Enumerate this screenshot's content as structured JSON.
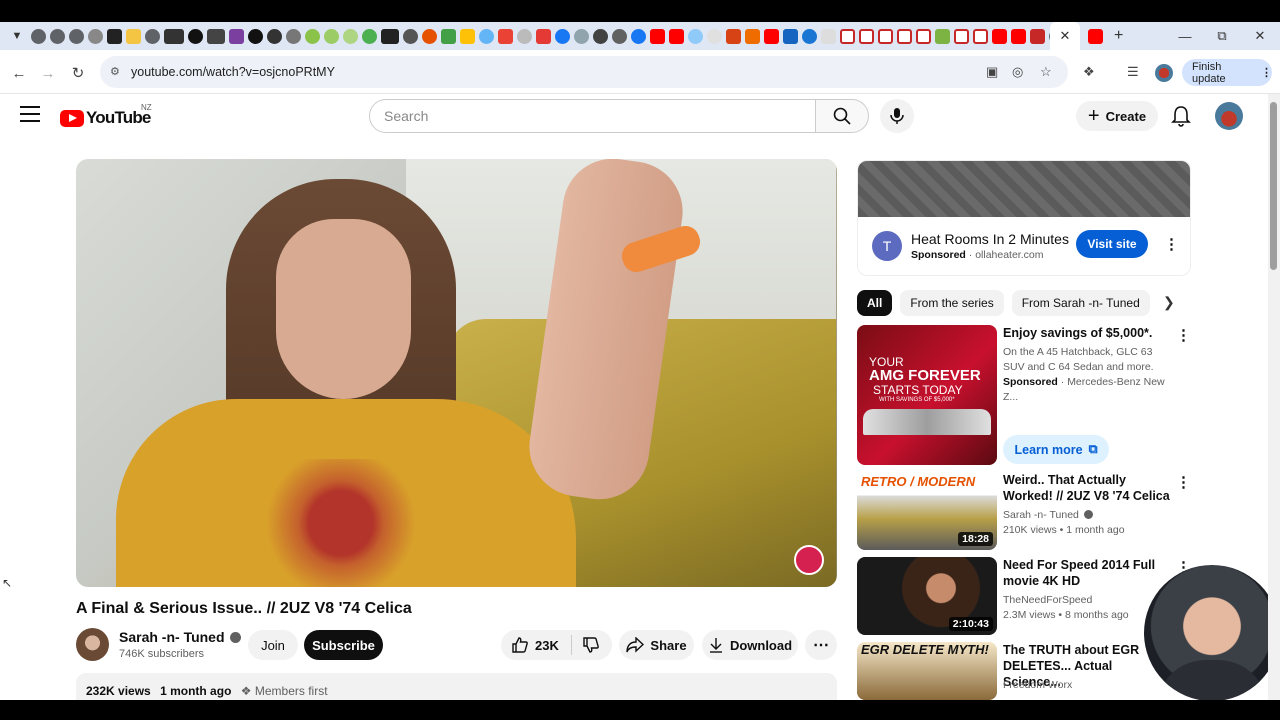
{
  "browser": {
    "url": "youtube.com/watch?v=osjcnoPRtMY",
    "finish_update": "Finish update"
  },
  "youtube": {
    "logo_text": "YouTube",
    "country": "NZ",
    "search_placeholder": "Search",
    "create_label": "Create"
  },
  "video": {
    "title": "A Final & Serious Issue.. // 2UZ V8 '74 Celica",
    "channel": "Sarah -n- Tuned",
    "subscribers": "746K subscribers",
    "join_label": "Join",
    "subscribe_label": "Subscribe",
    "likes": "23K",
    "share_label": "Share",
    "download_label": "Download",
    "views": "232K views",
    "age": "1 month ago",
    "members_first": "Members first"
  },
  "ad": {
    "letter": "T",
    "title": "Heat Rooms In 2 Minutes",
    "sponsored": "Sponsored",
    "domain": "ollaheater.com",
    "visit_label": "Visit site"
  },
  "chips": [
    "All",
    "From the series",
    "From Sarah -n- Tuned"
  ],
  "recommendations": [
    {
      "title": "Enjoy savings of $5,000*.",
      "desc": "On the A 45 Hatchback, GLC 63 SUV and C 64 Sedan and more.",
      "sponsored": "Sponsored",
      "advertiser": "Mercedes-Benz New Z...",
      "learn_more": "Learn more",
      "thumb_line1": "YOUR",
      "thumb_line2": "AMG FOREVER",
      "thumb_line3": "STARTS TODAY",
      "thumb_line4": "WITH SAVINGS OF $5,000*"
    },
    {
      "title": "Weird.. That Actually Worked! // 2UZ V8 '74 Celica",
      "channel": "Sarah -n- Tuned",
      "meta": "210K views • 1 month ago",
      "duration": "18:28",
      "thumb_text": "RETRO / MODERN"
    },
    {
      "title": "Need For Speed 2014 Full movie 4K HD",
      "channel": "TheNeedForSpeed",
      "meta": "2.3M views • 8 months ago",
      "duration": "2:10:43"
    },
    {
      "title": "The TRUTH about EGR DELETES... Actual Science...",
      "channel": "Freedom Worx",
      "thumb_text": "EGR DELETE MYTH!"
    }
  ],
  "icons": {
    "menu": "hamburger-icon",
    "search": "search-icon",
    "mic": "mic-icon",
    "bell": "bell-icon",
    "like": "thumbs-up-icon",
    "dislike": "thumbs-down-icon",
    "share": "share-icon",
    "download": "download-icon"
  },
  "colors": {
    "brand_red": "#ff0000",
    "visit_blue": "#065fd4",
    "chip_active": "#0f0f0f"
  }
}
